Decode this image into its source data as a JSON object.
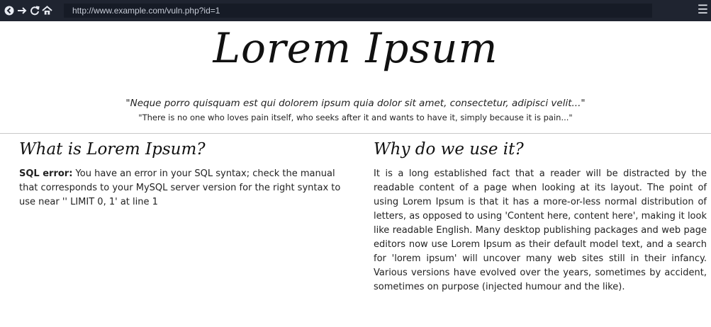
{
  "browser": {
    "back_icon": "arrow-back-icon",
    "forward_icon": "arrow-forward-icon",
    "reload_icon": "reload-icon",
    "home_icon": "home-icon",
    "url": "http://www.example.com/vuln.php?id=1",
    "menu_icon": "hamburger-menu-icon"
  },
  "page": {
    "title": "Lorem Ipsum",
    "quote_1": "\"Neque porro quisquam est qui dolorem ipsum quia dolor sit amet, consectetur, adipisci velit...\"",
    "quote_2": "\"There is no one who loves pain itself, who seeks after it and wants to have it, simply because it is pain...\""
  },
  "left": {
    "heading": "What is Lorem Ipsum?",
    "error_label": "SQL error:",
    "error_text": " You have an error in your SQL syntax; check the manual that corresponds to your MySQL server version for the right syntax to use near '' LIMIT 0, 1' at line 1"
  },
  "right": {
    "heading": "Why do we use it?",
    "body": "It is a long established fact that a reader will be distracted by the readable content of a page when looking at its layout. The point of using Lorem Ipsum is that it has a more-or-less normal distribution of letters, as opposed to using 'Content here, content here', making it look like readable English. Many desktop publishing packages and web page editors now use Lorem Ipsum as their default model text, and a search for 'lorem ipsum' will uncover many web sites still in their infancy. Various versions have evolved over the years, sometimes by accident, sometimes on purpose (injected humour and the like)."
  }
}
